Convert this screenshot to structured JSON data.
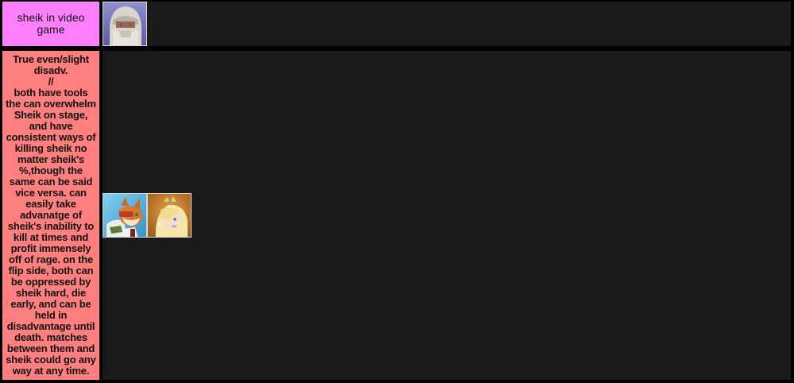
{
  "header_row": {
    "label": "sheik in video game",
    "label_color": "#ff7fff",
    "characters": [
      {
        "name": "sheik-portrait-icon"
      }
    ]
  },
  "tier_row": {
    "label": "True even/slight disadv.\n//\nboth have tools the can overwhelm Sheik on stage, and have consistent ways of killing sheik no matter sheik's %,though the same can be said vice versa. can easily take advanatge of sheik's inability to kill at times and profit immensely off of rage. on the flip side, both can be oppressed by sheik hard, die early, and can be held in disadvantage until death. matches between them and sheik could go any way at any time.",
    "label_color": "#ff7f7f",
    "characters": [
      {
        "name": "fox-portrait-icon"
      },
      {
        "name": "rosalina-portrait-icon"
      }
    ]
  },
  "background_color": "#1a1a1a"
}
